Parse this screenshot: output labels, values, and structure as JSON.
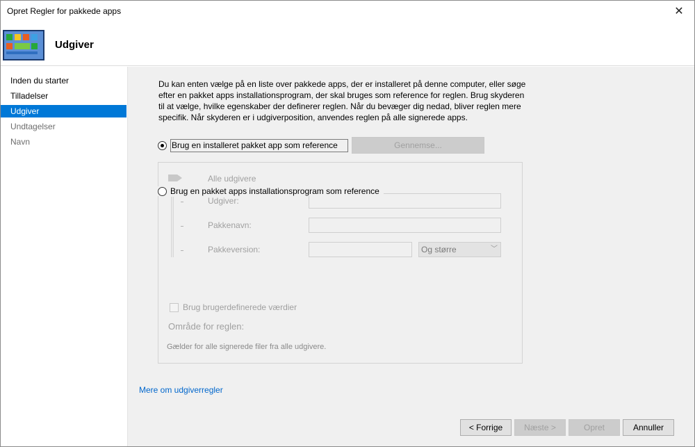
{
  "window": {
    "title": "Opret Regler for pakkede apps"
  },
  "header": {
    "title": "Udgiver"
  },
  "sidebar": {
    "items": [
      {
        "label": "Inden du starter",
        "state": "done"
      },
      {
        "label": "Tilladelser",
        "state": "done"
      },
      {
        "label": "Udgiver",
        "state": "active"
      },
      {
        "label": "Undtagelser",
        "state": "pending"
      },
      {
        "label": "Navn",
        "state": "pending"
      }
    ]
  },
  "main": {
    "description": "Du kan enten vælge på en liste over pakkede apps, der er installeret på denne computer, eller søge efter en pakket apps installationsprogram, der skal bruges som reference for reglen. Brug skyderen til at vælge, hvilke egenskaber der definerer reglen. Når du bevæger dig nedad, bliver reglen mere specifik. Når skyderen er i udgiverposition, anvendes reglen på alle signerede apps.",
    "option_installed": "Brug en installeret pakket app som reference",
    "option_installer": "Brug en pakket apps installationsprogram som reference",
    "browse_button": "Gennemse...",
    "slider_label": "Alle udgivere",
    "fields": {
      "publisher_label": "Udgiver:",
      "package_name_label": "Pakkenavn:",
      "package_version_label": "Pakkeversion:",
      "version_compare_value": "Og større"
    },
    "custom_values_label": "Brug brugerdefinerede værdier",
    "scope_heading": "Område for reglen:",
    "scope_text": "Gælder for alle signerede filer fra alle udgivere.",
    "more_link": "Mere om udgiverregler"
  },
  "footer": {
    "back": "< Forrige",
    "next": "Næste >",
    "create": "Opret",
    "cancel": "Annuller"
  },
  "colors": {
    "accent": "#0078d7",
    "link": "#0066cc",
    "content_bg": "#f0f0f0",
    "disabled_text": "#a0a0a0"
  }
}
